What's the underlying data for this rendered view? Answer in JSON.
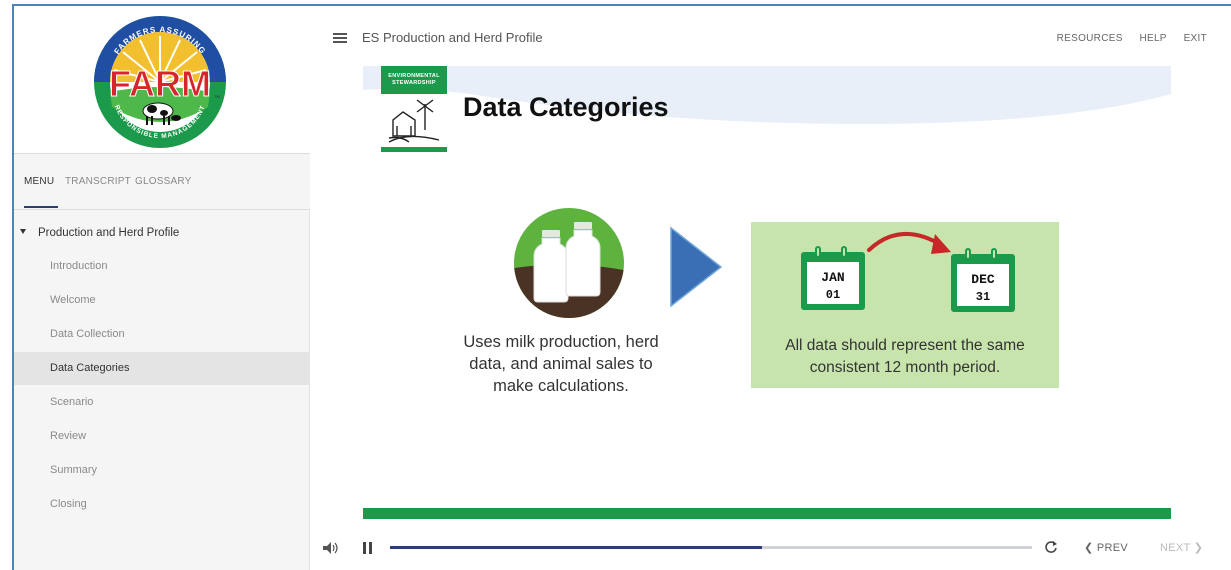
{
  "logo": {
    "arc_text": "FARMERS ASSURING",
    "brand": "FARM",
    "tm": "TM",
    "bottom_text": "RESPONSIBLE MANAGEMENT"
  },
  "sidebar": {
    "tabs": [
      {
        "label": "MENU"
      },
      {
        "label": "TRANSCRIPT"
      },
      {
        "label": "GLOSSARY"
      }
    ],
    "section_label": "Production and Herd Profile",
    "items": [
      {
        "label": "Introduction"
      },
      {
        "label": "Welcome"
      },
      {
        "label": "Data Collection"
      },
      {
        "label": "Data Categories"
      },
      {
        "label": "Scenario"
      },
      {
        "label": "Review"
      },
      {
        "label": "Summary"
      },
      {
        "label": "Closing"
      }
    ],
    "active_item": "Data Categories"
  },
  "topbar": {
    "course_title": "ES Production and Herd Profile",
    "links": [
      "RESOURCES",
      "HELP",
      "EXIT"
    ]
  },
  "slide": {
    "badge_text": "ENVIRONMENTAL STEWARDSHIP",
    "title": "Data Categories",
    "left_caption": "Uses milk production, herd data, and animal sales to make calculations.",
    "calendar_start": {
      "month": "JAN",
      "day": "01"
    },
    "calendar_end": {
      "month": "DEC",
      "day": "31"
    },
    "right_caption": "All data should represent the same consistent 12 month period."
  },
  "player": {
    "progress": 0.58,
    "prev_label": "PREV",
    "next_label": "NEXT"
  },
  "colors": {
    "brand_green": "#1a9a4a",
    "light_green": "#c8e4ad",
    "navy": "#2c3e70",
    "arrow_blue": "#3a6fb5",
    "arrow_red": "#c62828"
  }
}
